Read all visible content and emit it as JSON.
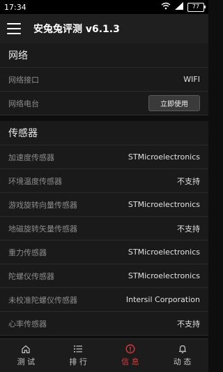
{
  "status_bar": {
    "time": "17:34",
    "battery": "77"
  },
  "app_bar": {
    "title": "安兔兔评测 v6.1.3"
  },
  "network": {
    "header": "网络",
    "rows": [
      {
        "label": "网络接口",
        "value": "WIFI"
      },
      {
        "label": "网络电台",
        "button": "立即使用"
      }
    ]
  },
  "sensors": {
    "header": "传感器",
    "rows": [
      {
        "label": "加速度传感器",
        "value": "STMicroelectronics"
      },
      {
        "label": "环境温度传感器",
        "value": "不支持"
      },
      {
        "label": "游戏旋转向量传感器",
        "value": "STMicroelectronics"
      },
      {
        "label": "地磁旋转矢量传感器",
        "value": "不支持"
      },
      {
        "label": "重力传感器",
        "value": "STMicroelectronics"
      },
      {
        "label": "陀螺仪传感器",
        "value": "STMicroelectronics"
      },
      {
        "label": "未校准陀螺仪传感器",
        "value": "Intersil Corporation"
      },
      {
        "label": "心率传感器",
        "value": "不支持"
      }
    ]
  },
  "bottom_nav": [
    {
      "label": "测 试",
      "icon": "home-icon",
      "active": false
    },
    {
      "label": "排 行",
      "icon": "list-icon",
      "active": false
    },
    {
      "label": "信 息",
      "icon": "info-icon",
      "active": true
    },
    {
      "label": "动 态",
      "icon": "bell-icon",
      "active": false
    }
  ],
  "colors": {
    "active": "#e23b3b",
    "app_bar": "#1f1f1f",
    "background": "#0e0e0e"
  }
}
